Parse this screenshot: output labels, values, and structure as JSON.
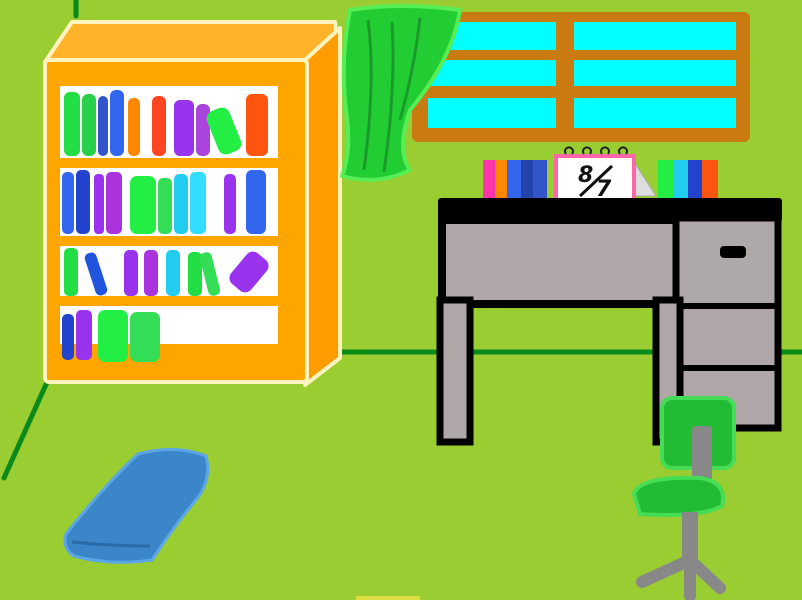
{
  "scene": {
    "name": "Room",
    "colors": {
      "wall": "#9acd32",
      "floor_line": "#0a8a1a",
      "bookshelf": "#ffa500",
      "window_frame": "#c97a10",
      "window_glass": "#00ffff",
      "curtain": "#22cc33",
      "desk": "#b0a8a8",
      "desk_outline": "#000000",
      "chair_seat": "#22bb33",
      "chair_metal": "#888888",
      "cushion": "#3a86c8"
    }
  },
  "calendar": {
    "month": "8",
    "day": "7"
  },
  "objects": {
    "bookshelf": "bookshelf",
    "window": "window",
    "curtain": "curtain",
    "desk": "desk",
    "desk_drawer": "desk-drawer",
    "chair": "office-chair",
    "cushion": "floor-cushion",
    "calendar": "desk-calendar"
  }
}
